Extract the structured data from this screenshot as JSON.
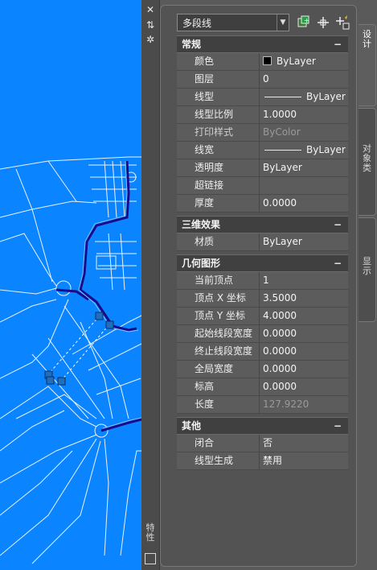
{
  "toolbar": {
    "object_type": "多段线"
  },
  "sections": [
    {
      "title": "常规",
      "toggle": "−",
      "rows": [
        {
          "label": "颜色",
          "value": "ByLayer",
          "kind": "color"
        },
        {
          "label": "图层",
          "value": "0"
        },
        {
          "label": "线型",
          "value": "ByLayer",
          "kind": "linetype"
        },
        {
          "label": "线型比例",
          "value": "1.0000"
        },
        {
          "label": "打印样式",
          "value": "ByColor",
          "dim": true
        },
        {
          "label": "线宽",
          "value": "ByLayer",
          "kind": "linetype"
        },
        {
          "label": "透明度",
          "value": "ByLayer"
        },
        {
          "label": "超链接",
          "value": ""
        },
        {
          "label": "厚度",
          "value": "0.0000"
        }
      ]
    },
    {
      "title": "三维效果",
      "toggle": "−",
      "rows": [
        {
          "label": "材质",
          "value": "ByLayer"
        }
      ]
    },
    {
      "title": "几何图形",
      "toggle": "−",
      "rows": [
        {
          "label": "当前顶点",
          "value": "1"
        },
        {
          "label": "顶点 X 坐标",
          "value": "3.5000"
        },
        {
          "label": "顶点 Y 坐标",
          "value": "4.0000"
        },
        {
          "label": "起始线段宽度",
          "value": "0.0000"
        },
        {
          "label": "终止线段宽度",
          "value": "0.0000"
        },
        {
          "label": "全局宽度",
          "value": "0.0000"
        },
        {
          "label": "标高",
          "value": "0.0000"
        },
        {
          "label": "长度",
          "value": "127.9220",
          "dim": true
        }
      ]
    },
    {
      "title": "其他",
      "toggle": "−",
      "rows": [
        {
          "label": "闭合",
          "value": "否"
        },
        {
          "label": "线型生成",
          "value": "禁用"
        }
      ]
    }
  ],
  "side_tabs": {
    "design": "设计",
    "object": "对象类",
    "display": "显示"
  },
  "palette_title": "特性",
  "icons": {
    "close": "close-icon",
    "autohide": "autohide-icon",
    "settings": "settings-icon",
    "quick_select": "quick-select-icon",
    "select_objects": "select-objects-icon",
    "toggle_pickadd": "pickadd-icon"
  },
  "colors": {
    "canvas_bg": "#0a84ff",
    "palette_bg": "#5a5a5a"
  }
}
